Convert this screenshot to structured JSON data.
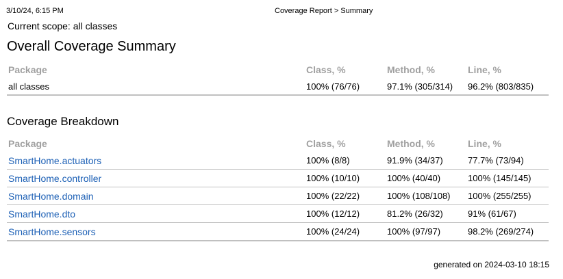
{
  "print_header": {
    "date": "3/10/24, 6:15 PM",
    "title": "Coverage Report > Summary"
  },
  "scope_text": "Current scope: all classes",
  "summary": {
    "title": "Overall Coverage Summary",
    "headers": [
      "Package",
      "Class, %",
      "Method, %",
      "Line, %"
    ],
    "row": {
      "package": "all classes",
      "class": "100% (76/76)",
      "method": "97.1% (305/314)",
      "line": "96.2% (803/835)"
    }
  },
  "breakdown": {
    "title": "Coverage Breakdown",
    "headers": [
      "Package",
      "Class, %",
      "Method, %",
      "Line, %"
    ],
    "rows": [
      {
        "package": "SmartHome.actuators",
        "class": "100% (8/8)",
        "method": "91.9% (34/37)",
        "line": "77.7% (73/94)"
      },
      {
        "package": "SmartHome.controller",
        "class": "100% (10/10)",
        "method": "100% (40/40)",
        "line": "100% (145/145)"
      },
      {
        "package": "SmartHome.domain",
        "class": "100% (22/22)",
        "method": "100% (108/108)",
        "line": "100% (255/255)"
      },
      {
        "package": "SmartHome.dto",
        "class": "100% (12/12)",
        "method": "81.2% (26/32)",
        "line": "91% (61/67)"
      },
      {
        "package": "SmartHome.sensors",
        "class": "100% (24/24)",
        "method": "100% (97/97)",
        "line": "98.2% (269/274)"
      }
    ]
  },
  "footer": {
    "generated": "generated on 2024-03-10 18:15"
  },
  "colors": {
    "link": "#1b5fb5",
    "header_text": "#a0a0a0",
    "rule": "#c0c0c0"
  }
}
